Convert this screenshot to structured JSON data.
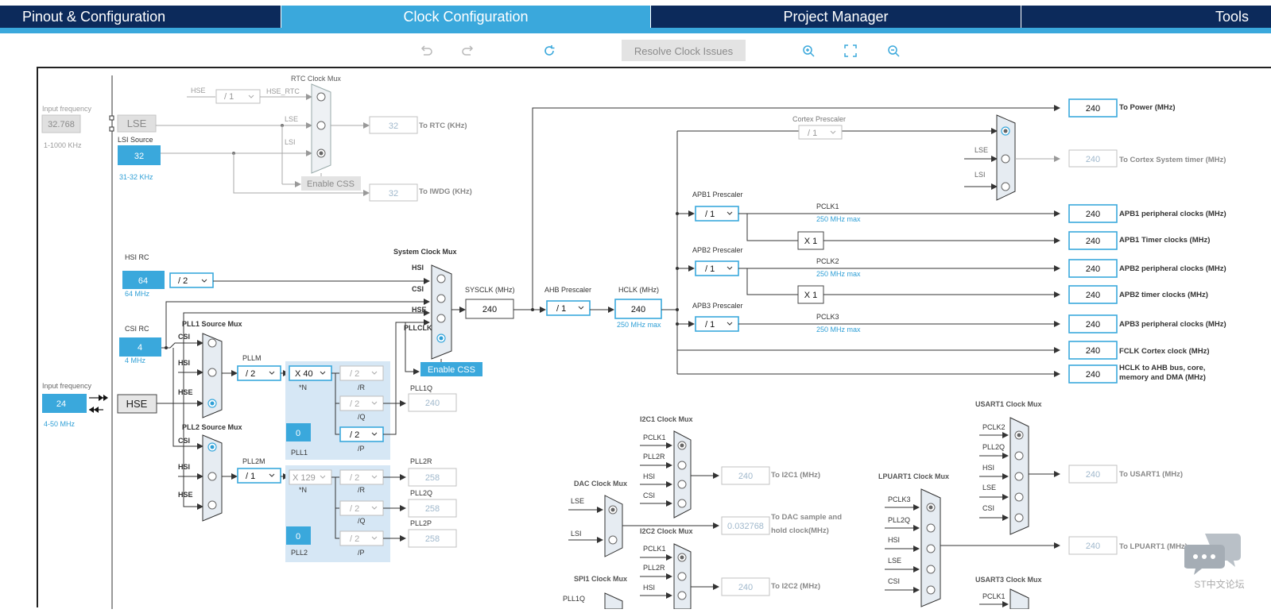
{
  "tabs": [
    {
      "label": "Pinout & Configuration",
      "active": false
    },
    {
      "label": "Clock Configuration",
      "active": true
    },
    {
      "label": "Project Manager",
      "active": false
    },
    {
      "label": "Tools",
      "active": false
    }
  ],
  "toolbar": {
    "resolve_label": "Resolve Clock Issues",
    "icons": [
      "undo-icon",
      "redo-icon",
      "refresh-icon",
      "zoom-in-icon",
      "fit-screen-icon",
      "zoom-out-icon"
    ]
  },
  "lse": {
    "input_freq_label": "Input frequency",
    "input_freq_value": "32.768",
    "input_freq_range": "1-1000 KHz",
    "osc_label": "LSE"
  },
  "lsi": {
    "label": "LSI Source",
    "value": "32",
    "range": "31-32 KHz"
  },
  "hsi": {
    "label": "HSI RC",
    "value": "64",
    "freq": "64 MHz",
    "div": "/ 2"
  },
  "csi": {
    "label": "CSI RC",
    "value": "4",
    "freq": "4 MHz"
  },
  "hse": {
    "input_freq_label": "Input frequency",
    "input_freq_value": "24",
    "input_freq_range": "4-50 MHz",
    "osc_label": "HSE"
  },
  "rtc": {
    "mux_label": "RTC Clock Mux",
    "hse_div": "/ 1",
    "hse_rtc_label": "HSE_RTC",
    "in_hse": "HSE",
    "in_lse": "LSE",
    "in_lsi": "LSI",
    "out_value": "32",
    "out_label": "To RTC (KHz)",
    "enable_css": "Enable CSS",
    "iwdg_value": "32",
    "iwdg_label": "To IWDG (KHz)"
  },
  "pll1": {
    "src_mux_label": "PLL1 Source Mux",
    "in_csi": "CSI",
    "in_hsi": "HSI",
    "in_hse": "HSE",
    "pllm_label": "PLLM",
    "pllm": "/ 2",
    "n": "X 40",
    "n_label": "*N",
    "r": "/ 2",
    "r_label": "/R",
    "q": "/ 2",
    "q_label": "/Q",
    "p": "/ 2",
    "p_label": "/P",
    "frac": "0",
    "name": "PLL1",
    "q_out_label": "PLL1Q",
    "q_out": "240"
  },
  "pll2": {
    "src_mux_label": "PLL2 Source Mux",
    "in_csi": "CSI",
    "in_hsi": "HSI",
    "in_hse": "HSE",
    "pllm_label": "PLL2M",
    "pllm": "/ 1",
    "n": "X 129",
    "n_label": "*N",
    "r": "/ 2",
    "r_label": "/R",
    "q": "/ 2",
    "q_label": "/Q",
    "p": "/ 2",
    "p_label": "/P",
    "frac": "0",
    "name": "PLL2",
    "r_out_label": "PLL2R",
    "r_out": "258",
    "q_out_label": "PLL2Q",
    "q_out": "258",
    "p_out_label": "PLL2P",
    "p_out": "258"
  },
  "sysclk": {
    "mux_label": "System Clock Mux",
    "in_hsi": "HSI",
    "in_csi": "CSI",
    "in_hse": "HSE",
    "in_pllclk": "PLLCLK",
    "label": "SYSCLK (MHz)",
    "value": "240",
    "enable_css": "Enable CSS"
  },
  "ahb": {
    "label": "AHB Prescaler",
    "value": "/ 1"
  },
  "hclk": {
    "label": "HCLK (MHz)",
    "value": "240",
    "max": "250 MHz max"
  },
  "cortex": {
    "label": "Cortex Prescaler",
    "value": "/ 1",
    "in_lse": "LSE",
    "in_lsi": "LSI",
    "out_value": "240",
    "out_label": "To Cortex System timer (MHz)"
  },
  "power": {
    "value": "240",
    "label": "To Power (MHz)"
  },
  "apb1": {
    "label": "APB1 Prescaler",
    "value": "/ 1",
    "pclk": "PCLK1",
    "max": "250 MHz max",
    "periph_value": "240",
    "periph_label": "APB1 peripheral clocks (MHz)",
    "timer_mult": "X 1",
    "timer_value": "240",
    "timer_label": "APB1 Timer clocks (MHz)"
  },
  "apb2": {
    "label": "APB2 Prescaler",
    "value": "/ 1",
    "pclk": "PCLK2",
    "max": "250 MHz max",
    "periph_value": "240",
    "periph_label": "APB2 peripheral clocks (MHz)",
    "timer_mult": "X 1",
    "timer_value": "240",
    "timer_label": "APB2 timer clocks (MHz)"
  },
  "apb3": {
    "label": "APB3 Prescaler",
    "value": "/ 1",
    "pclk": "PCLK3",
    "max": "250 MHz max",
    "periph_value": "240",
    "periph_label": "APB3 peripheral clocks (MHz)"
  },
  "fclk": {
    "value": "240",
    "label": "FCLK Cortex clock (MHz)"
  },
  "hclk_bus": {
    "value": "240",
    "label_line1": "HCLK to AHB bus, core,",
    "label_line2": "memory and DMA (MHz)"
  },
  "i2c1": {
    "mux_label": "I2C1 Clock Mux",
    "inputs": [
      "PCLK1",
      "PLL2R",
      "HSI",
      "CSI"
    ],
    "out_value": "240",
    "out_label": "To I2C1 (MHz)"
  },
  "dac": {
    "mux_label": "DAC Clock Mux",
    "inputs": [
      "LSE",
      "LSI"
    ],
    "out_value": "0.032768",
    "out_label_line1": "To DAC sample and",
    "out_label_line2": "hold clock(MHz)"
  },
  "i2c2": {
    "mux_label": "I2C2 Clock Mux",
    "inputs": [
      "PCLK1",
      "PLL2R",
      "HSI"
    ],
    "out_value": "240",
    "out_label": "To I2C2 (MHz)"
  },
  "spi1": {
    "mux_label": "SPI1 Clock Mux",
    "inputs": [
      "PLL1Q"
    ]
  },
  "usart1": {
    "mux_label": "USART1 Clock Mux",
    "inputs": [
      "PCLK2",
      "PLL2Q",
      "HSI",
      "LSE",
      "CSI"
    ],
    "out_value": "240",
    "out_label": "To USART1 (MHz)"
  },
  "lpuart1": {
    "mux_label": "LPUART1 Clock Mux",
    "inputs": [
      "PCLK3",
      "PLL2Q",
      "HSI",
      "LSE",
      "CSI"
    ],
    "out_value": "240",
    "out_label": "To LPUART1 (MHz)"
  },
  "usart3": {
    "mux_label": "USART3 Clock Mux",
    "inputs": [
      "PCLK1"
    ]
  },
  "watermark": "ST中文论坛",
  "colors": {
    "navy": "#0c2a5b",
    "accent": "#3aa8dc",
    "text": "#333333"
  }
}
